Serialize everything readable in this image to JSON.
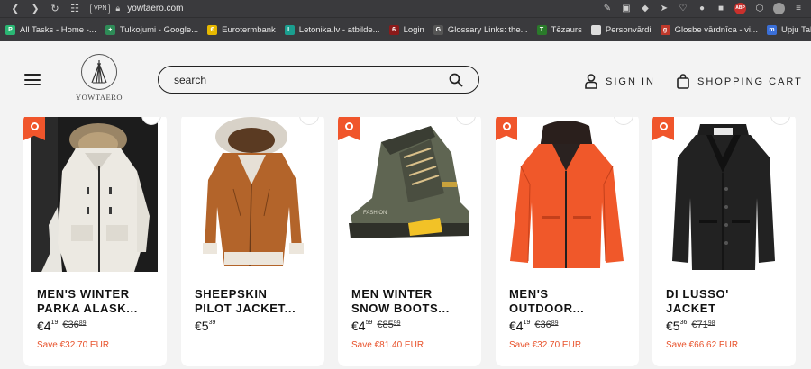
{
  "browser": {
    "vpn_label": "VPN",
    "url": "yowtaero.com"
  },
  "bookmarks": [
    {
      "label": "All Tasks - Home -...",
      "color": "#2ab673",
      "glyph": "P"
    },
    {
      "label": "Tulkojumi - Google...",
      "color": "#2e8b57",
      "glyph": "+"
    },
    {
      "label": "Eurotermbank",
      "color": "#e6b800",
      "glyph": "€"
    },
    {
      "label": "Letonika.lv - atbilde...",
      "color": "#1a9e8f",
      "glyph": "L"
    },
    {
      "label": "Login",
      "color": "#8b1a1a",
      "glyph": "6"
    },
    {
      "label": "Glossary Links: the...",
      "color": "#555555",
      "glyph": "G"
    },
    {
      "label": "Tēzaurs",
      "color": "#2a7a2a",
      "glyph": "T"
    },
    {
      "label": "Personvārdi",
      "color": "#dddddd",
      "glyph": ""
    },
    {
      "label": "Glosbe vārdnīca - vi...",
      "color": "#c0392b",
      "glyph": "g"
    },
    {
      "label": "Upju Takas",
      "color": "#3a6fd8",
      "glyph": "m"
    }
  ],
  "header": {
    "logo_text": "YOWTAERO",
    "search_placeholder": "search",
    "signin_label": "SIGN IN",
    "cart_label": "SHOPPING CART"
  },
  "products": [
    {
      "title": "MEN'S WINTER\nPARKA ALASK...",
      "price_main": "€4",
      "price_cents": "19",
      "old_main": "€36",
      "old_cents": "89",
      "save": "Save €32.70 EUR",
      "image": "white-parka-jacket"
    },
    {
      "title": "SHEEPSKIN\nPILOT JACKET...",
      "price_main": "€5",
      "price_cents": "39",
      "old_main": "",
      "old_cents": "",
      "save": "",
      "image": "brown-sheepskin-jacket"
    },
    {
      "title": "MEN WINTER\nSNOW BOOTS...",
      "price_main": "€4",
      "price_cents": "59",
      "old_main": "€85",
      "old_cents": "99",
      "save": "Save €81.40 EUR",
      "image": "green-snow-boot"
    },
    {
      "title": "MEN'S\nOUTDOOR...",
      "price_main": "€4",
      "price_cents": "19",
      "old_main": "€36",
      "old_cents": "89",
      "save": "Save €32.70 EUR",
      "image": "orange-outdoor-jacket"
    },
    {
      "title": "DI LUSSO'\nJACKET",
      "price_main": "€5",
      "price_cents": "36",
      "old_main": "€71",
      "old_cents": "98",
      "save": "Save €66.62 EUR",
      "image": "black-wool-coat"
    }
  ],
  "colors": {
    "accent": "#f0552b",
    "save_text": "#e8522b",
    "chrome": "#3a3a3d"
  }
}
